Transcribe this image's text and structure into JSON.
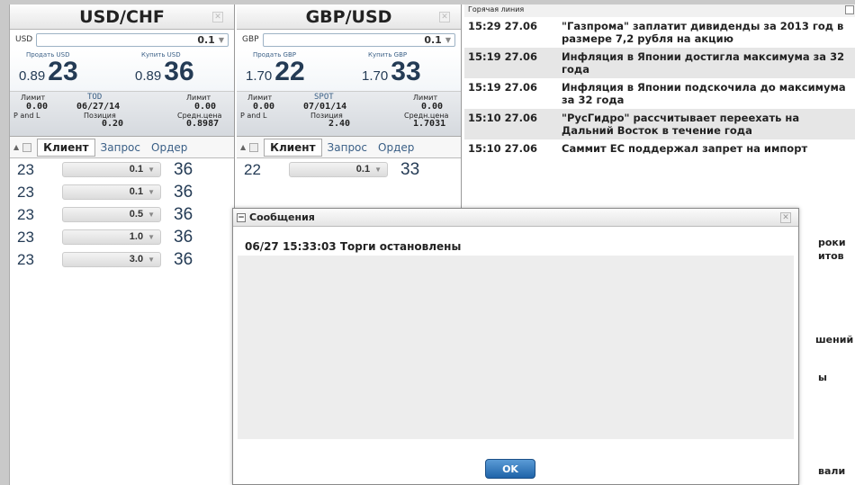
{
  "panel1": {
    "title": "USD/CHF",
    "ccy": "USD",
    "amount": "0.1",
    "sell_label": "Продать USD",
    "buy_label": "Купить USD",
    "sell_small": "0.89",
    "sell_big": "23",
    "buy_small": "0.89",
    "buy_big": "36",
    "limit1": "Лимит",
    "limit1_val": "0.00",
    "settle": "TOD",
    "date": "06/27/14",
    "limit2": "Лимит",
    "limit2_val": "0.00",
    "pl": "P and L",
    "position": "Позиция",
    "position_val": "0.20",
    "avg": "Средн.цена",
    "avg_val": "0.8987",
    "tabs": [
      "Клиент",
      "Запрос",
      "Ордер"
    ],
    "rows": [
      {
        "l": "23",
        "a": "0.1",
        "r": "36"
      },
      {
        "l": "23",
        "a": "0.1",
        "r": "36"
      },
      {
        "l": "23",
        "a": "0.5",
        "r": "36"
      },
      {
        "l": "23",
        "a": "1.0",
        "r": "36"
      },
      {
        "l": "23",
        "a": "3.0",
        "r": "36"
      }
    ]
  },
  "panel2": {
    "title": "GBP/USD",
    "ccy": "GBP",
    "amount": "0.1",
    "sell_label": "Продать GBP",
    "buy_label": "Купить GBP",
    "sell_small": "1.70",
    "sell_big": "22",
    "buy_small": "1.70",
    "buy_big": "33",
    "limit1": "Лимит",
    "limit1_val": "0.00",
    "settle": "SPOT",
    "date": "07/01/14",
    "limit2": "Лимит",
    "limit2_val": "0.00",
    "pl": "P and L",
    "position": "Позиция",
    "position_val": "2.40",
    "avg": "Средн.цена",
    "avg_val": "1.7031",
    "tabs": [
      "Клиент",
      "Запрос",
      "Ордер"
    ],
    "rows": [
      {
        "l": "22",
        "a": "0.1",
        "r": "33"
      }
    ]
  },
  "news": {
    "header": "Горячая линия",
    "items": [
      {
        "time": "15:29 27.06",
        "text": "\"Газпрома\" заплатит дивиденды за 2013 год в размере 7,2 рубля на акцию"
      },
      {
        "time": "15:19 27.06",
        "text": "Инфляция в Японии достигла максимума за 32 года"
      },
      {
        "time": "15:19 27.06",
        "text": "Инфляция в Японии подскочила до максимума за 32 года"
      },
      {
        "time": "15:10 27.06",
        "text": "\"РусГидро\" рассчитывает переехать на Дальний Восток в течение года"
      },
      {
        "time": "15:10 27.06",
        "text": "Саммит ЕС поддержал запрет на импорт"
      }
    ],
    "cut": [
      "роки",
      "итов",
      "шений",
      "ы",
      "вали"
    ]
  },
  "dialog": {
    "title": "Сообщения",
    "message": "06/27 15:33:03 Торги остановлены",
    "ok": "OK"
  }
}
